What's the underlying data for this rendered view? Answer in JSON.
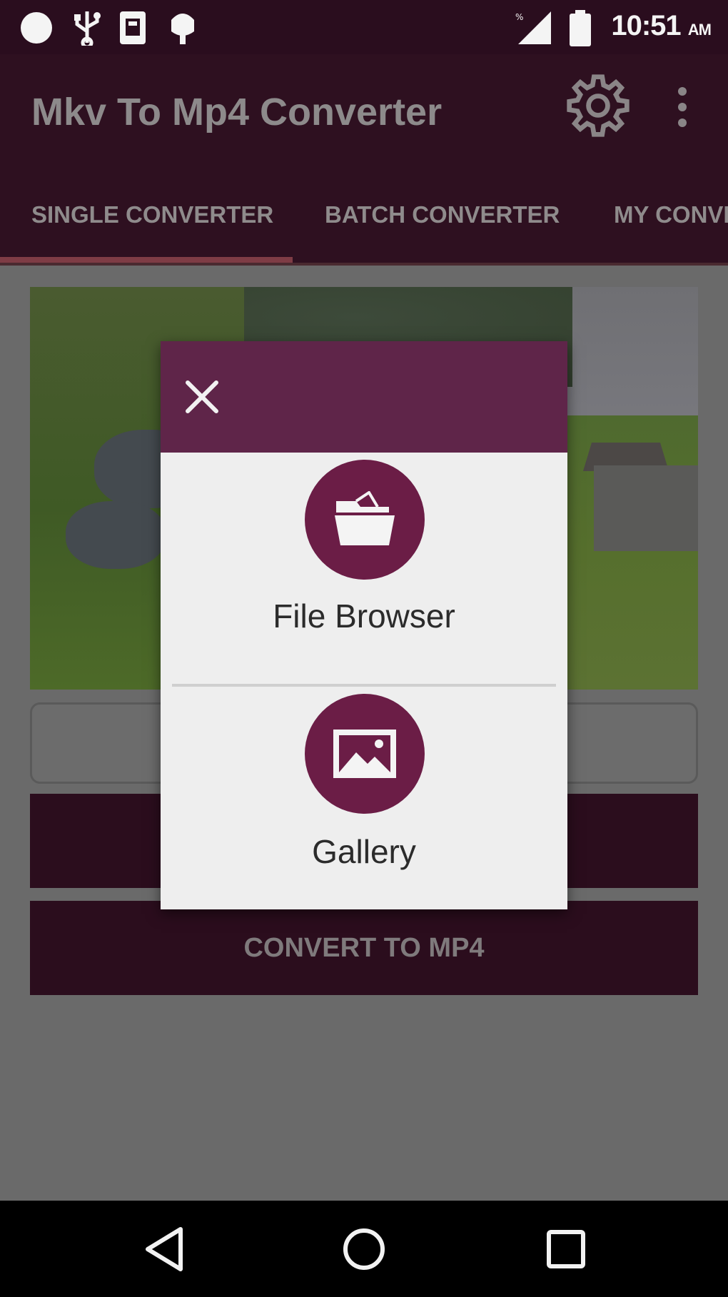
{
  "status_bar": {
    "time": "10:51",
    "ampm": "AM",
    "icons": [
      "notification-dot-icon",
      "usb-icon",
      "sim-card-icon",
      "android-debug-icon",
      "signal-icon",
      "battery-icon"
    ]
  },
  "app_bar": {
    "title": "Mkv To Mp4 Converter",
    "settings_icon": "gear-icon",
    "overflow_icon": "more-vert-icon"
  },
  "tabs": [
    {
      "label": "SINGLE CONVERTER",
      "selected": true
    },
    {
      "label": "BATCH CONVERTER",
      "selected": false
    },
    {
      "label": "MY CONVERSIONS",
      "selected": false
    }
  ],
  "main": {
    "convert_button_label": "CONVERT TO MP4"
  },
  "dialog": {
    "close_icon": "close-icon",
    "options": [
      {
        "label": "File Browser",
        "icon": "folder-open-icon"
      },
      {
        "label": "Gallery",
        "icon": "image-icon"
      }
    ]
  },
  "nav_bar": {
    "icons": [
      "back-icon",
      "home-icon",
      "recents-icon"
    ]
  },
  "colors": {
    "app_bar": "#2e1020",
    "dialog_header": "#5f2549",
    "accent": "#6b1d46",
    "dialog_bg": "#eeeeee"
  }
}
